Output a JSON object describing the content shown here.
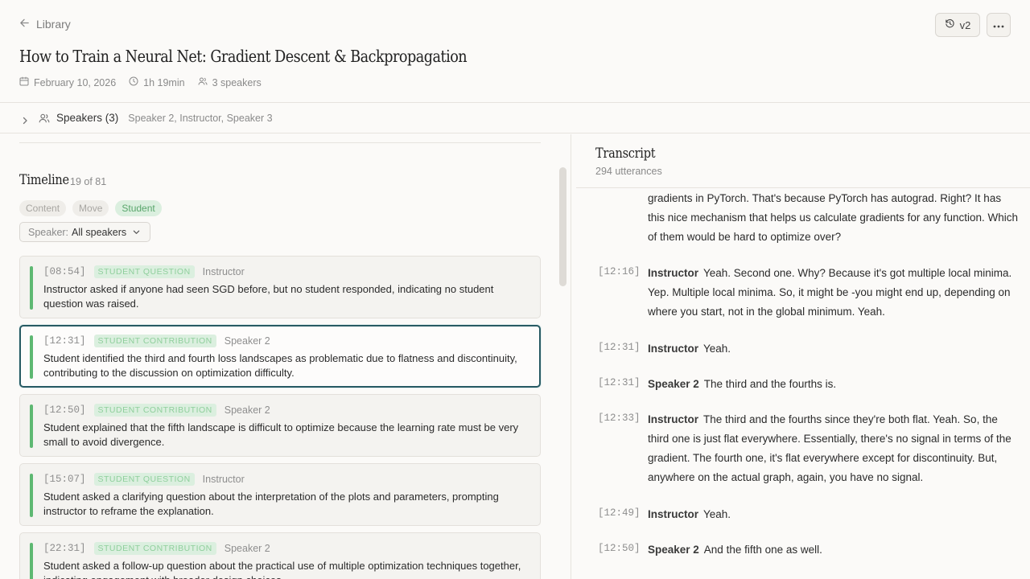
{
  "header": {
    "back_label": "Library",
    "title": "How to Train a Neural Net: Gradient Descent & Backpropagation",
    "date": "February 10, 2026",
    "duration": "1h 19min",
    "speakers_count": "3 speakers",
    "version_label": "v2"
  },
  "speakers_bar": {
    "label": "Speakers (3)",
    "names": "Speaker 2, Instructor, Speaker 3"
  },
  "timeline": {
    "title": "Timeline",
    "count": "19 of 81",
    "filters": [
      {
        "label": "Content",
        "active": false
      },
      {
        "label": "Move",
        "active": false
      },
      {
        "label": "Student",
        "active": true
      }
    ],
    "speaker_filter": {
      "key": "Speaker:",
      "value": "All speakers"
    },
    "cards": [
      {
        "time": "[08:54]",
        "tag": "STUDENT QUESTION",
        "speaker": "Instructor",
        "text": "Instructor asked if anyone had seen SGD before, but no student responded, indicating no student question was raised."
      },
      {
        "time": "[12:31]",
        "tag": "STUDENT CONTRIBUTION",
        "speaker": "Speaker 2",
        "text": "Student identified the third and fourth loss landscapes as problematic due to flatness and discontinuity, contributing to the discussion on optimization difficulty."
      },
      {
        "time": "[12:50]",
        "tag": "STUDENT CONTRIBUTION",
        "speaker": "Speaker 2",
        "text": "Student explained that the fifth landscape is difficult to optimize because the learning rate must be very small to avoid divergence."
      },
      {
        "time": "[15:07]",
        "tag": "STUDENT QUESTION",
        "speaker": "Instructor",
        "text": "Student asked a clarifying question about the interpretation of the plots and parameters, prompting instructor to reframe the explanation."
      },
      {
        "time": "[22:31]",
        "tag": "STUDENT CONTRIBUTION",
        "speaker": "Speaker 2",
        "text": "Student asked a follow-up question about the practical use of multiple optimization techniques together, indicating engagement with broader design choices."
      }
    ]
  },
  "transcript": {
    "title": "Transcript",
    "count": "294 utterances",
    "utterances": [
      {
        "time": "",
        "speaker": "",
        "text": "gradients in PyTorch. That's because PyTorch has autograd. Right? It has this nice mechanism that helps us calculate gradients for any function. Which of them would be hard to optimize over?"
      },
      {
        "time": "[12:16]",
        "speaker": "Instructor",
        "text": "Yeah. Second one. Why? Because it's got multiple local minima. Yep. Multiple local minima. So, it might be -you might end up, depending on where you start, not in the global minimum. Yeah."
      },
      {
        "time": "[12:31]",
        "speaker": "Instructor",
        "text": "Yeah."
      },
      {
        "time": "[12:31]",
        "speaker": "Speaker 2",
        "text": "The third and the fourths is."
      },
      {
        "time": "[12:33]",
        "speaker": "Instructor",
        "text": "The third and the fourths since they're both flat. Yeah. So, the third one is just flat everywhere. Essentially, there's no signal in terms of the gradient. The fourth one, it's flat everywhere except for discontinuity. But, anywhere on the actual graph, again, you have no signal."
      },
      {
        "time": "[12:49]",
        "speaker": "Instructor",
        "text": "Yeah."
      },
      {
        "time": "[12:50]",
        "speaker": "Speaker 2",
        "text": "And the fifth one as well."
      }
    ]
  }
}
